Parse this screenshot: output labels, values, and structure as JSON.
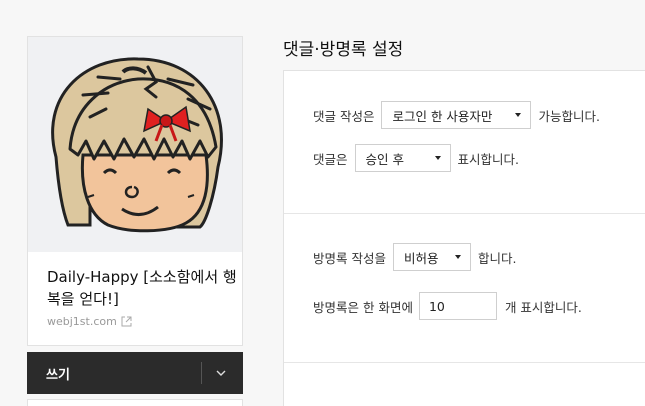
{
  "profile": {
    "blog_title": "Daily-Happy [소소함에서 행복을 얻다!]",
    "blog_url": "webj1st.com",
    "avatar_icon": "girl-avatar-illustration",
    "link_icon": "external-link-icon"
  },
  "write_menu": {
    "label": "쓰기",
    "toggle_icon": "chevron-down-icon"
  },
  "section": {
    "title": "댓글·방명록 설정"
  },
  "comment_settings": {
    "write_prefix": "댓글 작성은",
    "write_option": "로그인 한 사용자만",
    "write_suffix": "가능합니다.",
    "display_prefix": "댓글은",
    "display_option": "승인 후",
    "display_suffix": "표시합니다."
  },
  "guestbook_settings": {
    "write_prefix": "방명록 작성을",
    "write_option": "비허용",
    "write_suffix": "합니다.",
    "per_page_prefix": "방명록은 한 화면에",
    "per_page_value": "10",
    "per_page_suffix": "개 표시합니다."
  },
  "colors": {
    "write_bar_bg": "#2b2b2b",
    "page_bg": "#f7f7f7",
    "bow_red": "#e02020",
    "hair": "#d9c49a",
    "skin": "#f2c49b"
  }
}
